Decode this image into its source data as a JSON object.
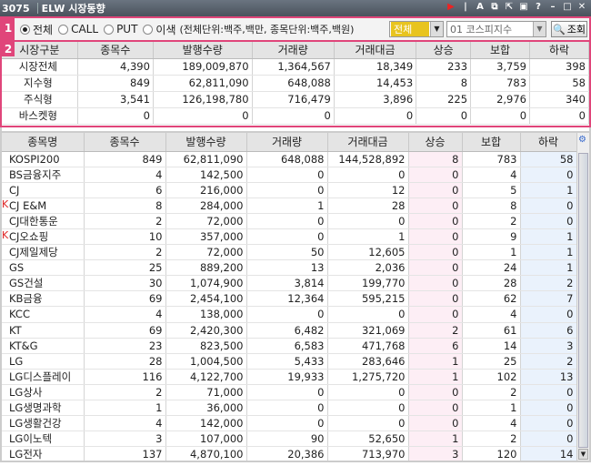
{
  "window": {
    "code": "3075",
    "title": "ELW 시장동향"
  },
  "controls": {
    "section_num": "1",
    "radios": [
      {
        "label": "전체",
        "checked": true
      },
      {
        "label": "CALL",
        "checked": false
      },
      {
        "label": "PUT",
        "checked": false
      },
      {
        "label": "이색",
        "checked": false
      }
    ],
    "unit_note": "(전체단위:백주,백만, 종목단위:백주,백원)",
    "select_type": "전체",
    "select_market": "01  코스피지수",
    "query_label": "조회"
  },
  "summary": {
    "section_num": "2",
    "headers": [
      "시장구분",
      "종목수",
      "발행수량",
      "거래량",
      "거래대금",
      "상승",
      "보합",
      "하락"
    ],
    "rows": [
      [
        "시장전체",
        "4,390",
        "189,009,870",
        "1,364,567",
        "18,349",
        "233",
        "3,759",
        "398"
      ],
      [
        "지수형",
        "849",
        "62,811,090",
        "648,088",
        "14,453",
        "8",
        "783",
        "58"
      ],
      [
        "주식형",
        "3,541",
        "126,198,780",
        "716,479",
        "3,896",
        "225",
        "2,976",
        "340"
      ],
      [
        "바스켓형",
        "0",
        "0",
        "0",
        "0",
        "0",
        "0",
        "0"
      ]
    ]
  },
  "main": {
    "headers": [
      "종목명",
      "종목수",
      "발행수량",
      "거래량",
      "거래대금",
      "상승",
      "보합",
      "하락"
    ],
    "rows": [
      {
        "k": false,
        "cells": [
          "KOSPI200",
          "849",
          "62,811,090",
          "648,088",
          "144,528,892",
          "8",
          "783",
          "58"
        ]
      },
      {
        "k": false,
        "cells": [
          "BS금융지주",
          "4",
          "142,500",
          "0",
          "0",
          "0",
          "4",
          "0"
        ]
      },
      {
        "k": false,
        "cells": [
          "CJ",
          "6",
          "216,000",
          "0",
          "12",
          "0",
          "5",
          "1"
        ]
      },
      {
        "k": true,
        "cells": [
          "CJ E&M",
          "8",
          "284,000",
          "1",
          "28",
          "0",
          "8",
          "0"
        ]
      },
      {
        "k": false,
        "cells": [
          "CJ대한통운",
          "2",
          "72,000",
          "0",
          "0",
          "0",
          "2",
          "0"
        ]
      },
      {
        "k": true,
        "cells": [
          "CJ오쇼핑",
          "10",
          "357,000",
          "0",
          "1",
          "0",
          "9",
          "1"
        ]
      },
      {
        "k": false,
        "cells": [
          "CJ제일제당",
          "2",
          "72,000",
          "50",
          "12,605",
          "0",
          "1",
          "1"
        ]
      },
      {
        "k": false,
        "cells": [
          "GS",
          "25",
          "889,200",
          "13",
          "2,036",
          "0",
          "24",
          "1"
        ]
      },
      {
        "k": false,
        "cells": [
          "GS건설",
          "30",
          "1,074,900",
          "3,814",
          "199,770",
          "0",
          "28",
          "2"
        ]
      },
      {
        "k": false,
        "cells": [
          "KB금융",
          "69",
          "2,454,100",
          "12,364",
          "595,215",
          "0",
          "62",
          "7"
        ]
      },
      {
        "k": false,
        "cells": [
          "KCC",
          "4",
          "138,000",
          "0",
          "0",
          "0",
          "4",
          "0"
        ]
      },
      {
        "k": false,
        "cells": [
          "KT",
          "69",
          "2,420,300",
          "6,482",
          "321,069",
          "2",
          "61",
          "6"
        ]
      },
      {
        "k": false,
        "cells": [
          "KT&G",
          "23",
          "823,500",
          "6,583",
          "471,768",
          "6",
          "14",
          "3"
        ]
      },
      {
        "k": false,
        "cells": [
          "LG",
          "28",
          "1,004,500",
          "5,433",
          "283,646",
          "1",
          "25",
          "2"
        ]
      },
      {
        "k": false,
        "cells": [
          "LG디스플레이",
          "116",
          "4,122,700",
          "19,933",
          "1,275,720",
          "1",
          "102",
          "13"
        ]
      },
      {
        "k": false,
        "cells": [
          "LG상사",
          "2",
          "71,000",
          "0",
          "0",
          "0",
          "2",
          "0"
        ]
      },
      {
        "k": false,
        "cells": [
          "LG생명과학",
          "1",
          "36,000",
          "0",
          "0",
          "0",
          "1",
          "0"
        ]
      },
      {
        "k": false,
        "cells": [
          "LG생활건강",
          "4",
          "142,000",
          "0",
          "0",
          "0",
          "4",
          "0"
        ]
      },
      {
        "k": false,
        "cells": [
          "LG이노텍",
          "3",
          "107,000",
          "90",
          "52,650",
          "1",
          "2",
          "0"
        ]
      },
      {
        "k": false,
        "cells": [
          "LG전자",
          "137",
          "4,870,100",
          "20,386",
          "713,970",
          "3",
          "120",
          "14"
        ]
      }
    ]
  },
  "colors": {
    "accent": "#e0457a",
    "up_bg": "#fdeef5",
    "down_bg": "#eaf2fc"
  }
}
